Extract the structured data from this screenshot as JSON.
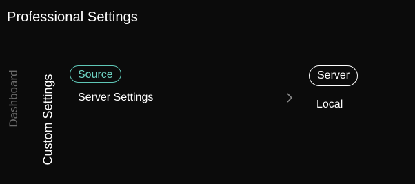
{
  "header": {
    "title": "Professional Settings"
  },
  "side_tabs": [
    {
      "label": "Dashboard",
      "active": false
    },
    {
      "label": "Custom Settings",
      "active": true
    }
  ],
  "menu": {
    "items": [
      {
        "label": "Source",
        "selected": true
      },
      {
        "label": "Server Settings",
        "has_submenu": true
      }
    ]
  },
  "options": {
    "items": [
      {
        "label": "Server",
        "selected": true
      },
      {
        "label": "Local",
        "selected": false
      }
    ]
  },
  "colors": {
    "background": "#0b0b0b",
    "accent": "#5fc7b7",
    "inactive_text": "#6b6b6b",
    "text": "#ffffff"
  }
}
